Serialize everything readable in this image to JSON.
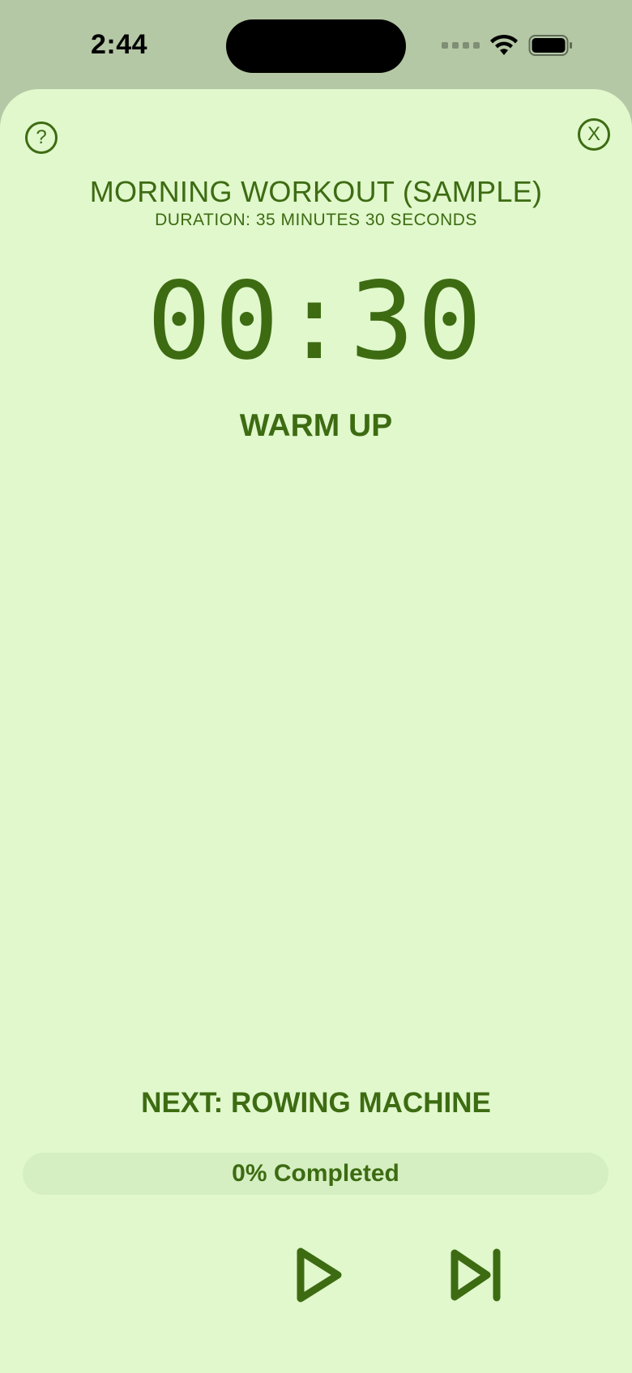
{
  "status_bar": {
    "time": "2:44"
  },
  "header": {
    "help_symbol": "?",
    "close_symbol": "X",
    "workout_title": "MORNING WORKOUT (SAMPLE)",
    "duration": "DURATION: 35 MINUTES 30 SECONDS"
  },
  "timer": {
    "display": "00:30",
    "phase": "WARM UP"
  },
  "footer": {
    "next_label": "NEXT: ROWING MACHINE",
    "progress_label": "0% Completed",
    "progress_fraction": 0
  },
  "icons": {
    "help": "help-icon",
    "close": "close-icon",
    "play": "play-icon",
    "skip": "skip-next-icon",
    "wifi": "wifi-icon",
    "battery": "battery-icon",
    "signal": "signal-icon"
  },
  "colors": {
    "accent": "#3d6b12",
    "background": "#e0f8cc",
    "status_bar_bg": "#b5c8a5",
    "progress_track": "#d6efc2"
  }
}
